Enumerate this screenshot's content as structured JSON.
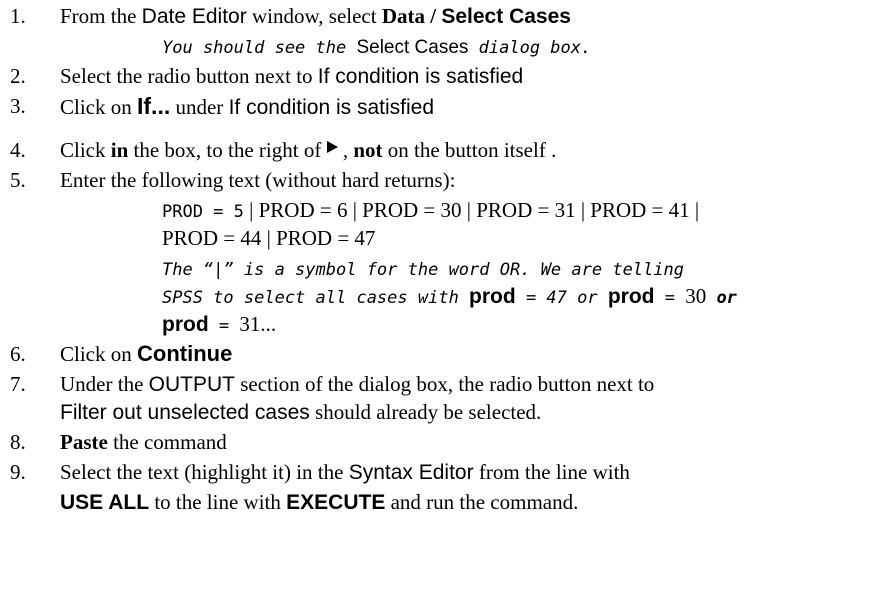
{
  "steps": [
    {
      "num": "1.",
      "a": "From the ",
      "b": "Date Editor",
      "c": " window, select ",
      "d": "Data",
      "e": " / ",
      "f": "Select Cases"
    },
    {
      "sub_a": "You should see the ",
      "sub_b": "Select Cases",
      "sub_c": " dialog box."
    },
    {
      "num": "2.",
      "a": "Select the radio button next to ",
      "b": "If condition is satisfied"
    },
    {
      "num": "3.",
      "a": "Click on ",
      "b": "If...",
      "c": " under ",
      "d": "If condition is satisfied"
    },
    {
      "num": "4.",
      "a": "Click ",
      "b": "in",
      "c": " the box, to the right of ",
      "d": " , ",
      "e": "not",
      "f": " on the button itself ."
    },
    {
      "num": "5.",
      "a": "Enter the following text (without hard returns):"
    },
    {
      "code1_a": "PROD  =  5",
      "code1_b": " | PROD = 6 | PROD = 30 | PROD = 31 | PROD = 41 |"
    },
    {
      "code2": "PROD = 44 | PROD = 47"
    },
    {
      "note1": "The “|” is a symbol for the word OR.  We are telling"
    },
    {
      "note2_a": "SPSS to select all cases with ",
      "note2_b": "prod",
      "note2_c": " = 47 or ",
      "note2_d": "prod",
      "note2_e": " = ",
      "note2_f": "30",
      "note2_g": " or"
    },
    {
      "note3_a": "prod",
      "note3_b": "  = ",
      "note3_c": "31..."
    },
    {
      "num": "6.",
      "a": "Click on ",
      "b": "Continue"
    },
    {
      "num": "7.",
      "a": "Under the ",
      "b": "OUTPUT",
      "c": " section of the dialog box, the radio button next to"
    },
    {
      "cont_a": "Filter out unselected cases",
      "cont_b": " should already be selected."
    },
    {
      "num": "8.",
      "a": "Paste",
      "b": " the command"
    },
    {
      "num": "9.",
      "a": "Select the text (highlight it) in the ",
      "b": "Syntax Editor",
      "c": " from the line with"
    },
    {
      "cont_a": "USE ALL",
      "cont_b": " to the line with ",
      "cont_c": "EXECUTE",
      "cont_d": " and run the command."
    }
  ]
}
